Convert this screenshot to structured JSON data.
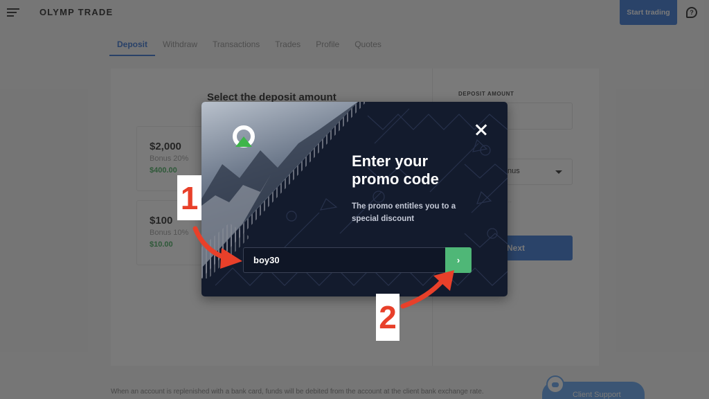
{
  "header": {
    "logo_text": "OLYMP TRADE",
    "start_trading_label": "Start trading",
    "help_icon": "?"
  },
  "tabs": [
    {
      "label": "Deposit",
      "active": true
    },
    {
      "label": "Withdraw",
      "active": false
    },
    {
      "label": "Transactions",
      "active": false
    },
    {
      "label": "Trades",
      "active": false
    },
    {
      "label": "Profile",
      "active": false
    },
    {
      "label": "Quotes",
      "active": false
    }
  ],
  "deposit": {
    "title": "Select the deposit amount",
    "cards": [
      {
        "amount": "$2,000",
        "bonus": "Bonus 20%",
        "bonus_value": "$400.00"
      },
      {
        "amount": "$100",
        "bonus": "Bonus 10%",
        "bonus_value": "$10.00"
      }
    ],
    "amount_label": "DEPOSIT AMOUNT",
    "bonus_select_value": "nus",
    "next_label": "Next"
  },
  "footer": {
    "note": "When an account is replenished with a bank card, funds will be debited from the account at the client bank exchange rate.",
    "support_label": "Client Support"
  },
  "modal": {
    "title_line1": "Enter your",
    "title_line2": "promo code",
    "subtitle": "The promo entitles you to a special discount",
    "promo_value": "boy30",
    "submit_symbol": "›",
    "colors": {
      "background": "#131b2d",
      "submit": "#4fb777",
      "logo_triangle": "#3fb54a"
    }
  },
  "annotations": {
    "step1": "1",
    "step2": "2",
    "color": "#e8402a"
  }
}
